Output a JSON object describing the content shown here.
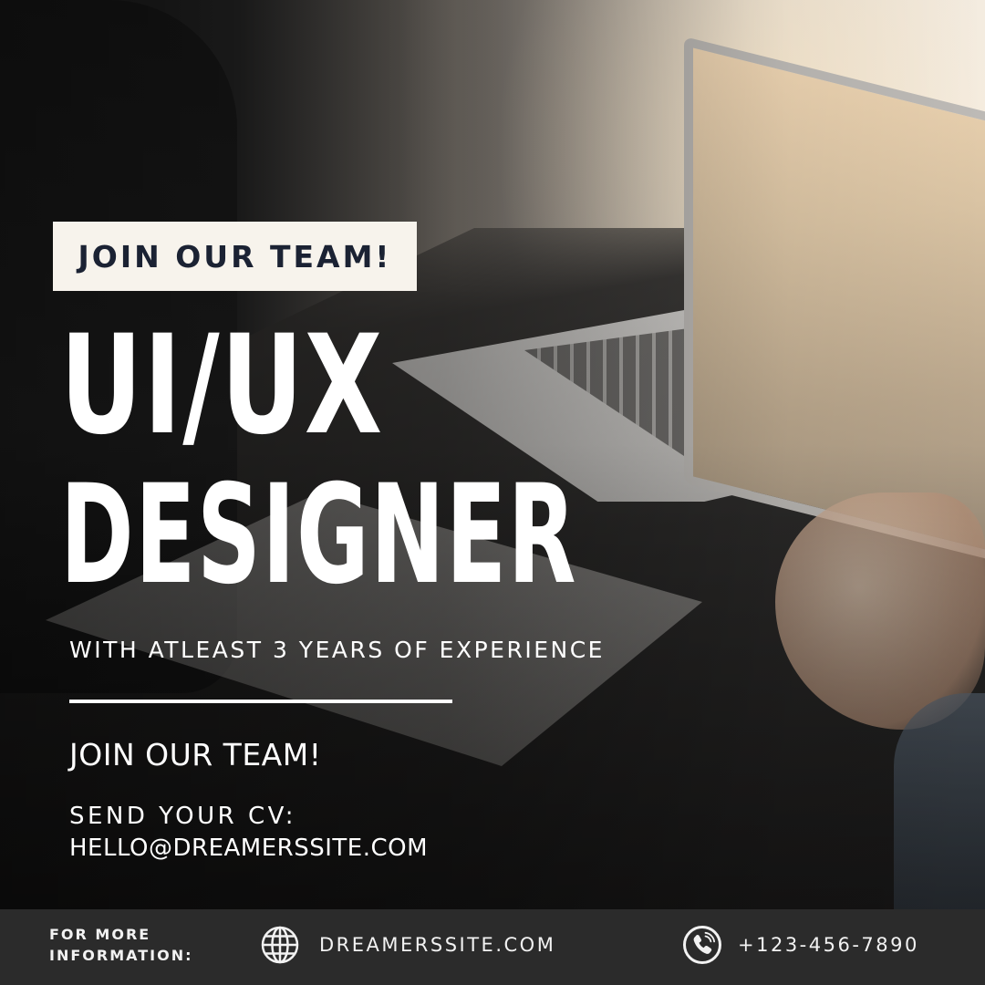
{
  "badge": {
    "text": "JOIN OUR TEAM!"
  },
  "headline": {
    "line1": "UI/UX",
    "line2": "DESIGNER"
  },
  "subheadline": "WITH ATLEAST 3 YEARS OF EXPERIENCE",
  "invite": "JOIN OUR TEAM!",
  "cv": {
    "label": "SEND YOUR CV:",
    "email": "HELLO@DREAMERSSITE.COM"
  },
  "footer": {
    "label_line1": "FOR MORE",
    "label_line2": "INFORMATION:",
    "website": "DREAMERSSITE.COM",
    "phone": "+123-456-7890",
    "website_icon": "globe-icon",
    "phone_icon": "phone-icon"
  },
  "colors": {
    "badge_bg": "#f7f3ec",
    "badge_text": "#1b2233",
    "footer_bg": "#2b2b2b",
    "text": "#ffffff"
  }
}
